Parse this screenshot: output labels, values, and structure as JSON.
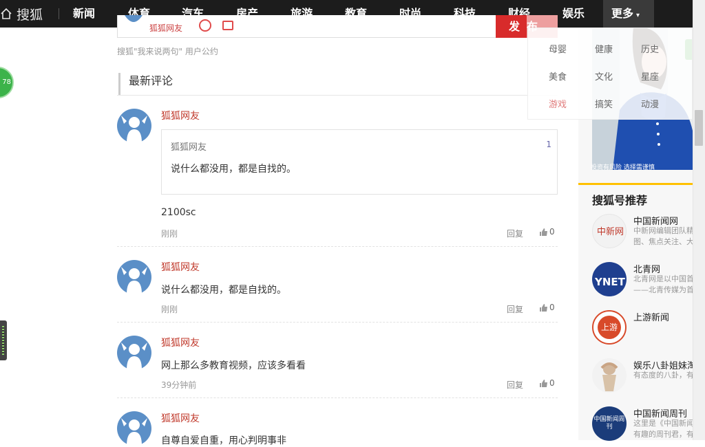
{
  "nav": {
    "logo": "搜狐",
    "items": [
      "新闻",
      "体育",
      "汽车",
      "房产",
      "旅游",
      "教育",
      "时尚",
      "科技",
      "财经",
      "娱乐"
    ],
    "more": "更多"
  },
  "more_menu": [
    "母婴",
    "健康",
    "历史",
    "美食",
    "文化",
    "星座",
    "游戏",
    "搞笑",
    "动漫"
  ],
  "comment_box": {
    "user_remnant": "狐狐网友",
    "post_button": "发布",
    "pact": "搜狐\"我来说两句\" 用户公约"
  },
  "latest_title": "最新评论",
  "comments": [
    {
      "user": "狐狐网友",
      "quote": {
        "user": "狐狐网友",
        "floor": "1",
        "text": "说什么都没用，都是自找的。"
      },
      "text": "2100sc",
      "time": "刚刚",
      "reply": "回复",
      "likes": "0"
    },
    {
      "user": "狐狐网友",
      "text": "说什么都没用，都是自找的。",
      "time": "刚刚",
      "reply": "回复",
      "likes": "0"
    },
    {
      "user": "狐狐网友",
      "text": "网上那么多教育视频，应该多看看",
      "time": "39分钟前",
      "reply": "回复",
      "likes": "0"
    },
    {
      "user": "狐狐网友",
      "text": "自尊自爱自重，用心判明事非"
    }
  ],
  "float_badge": "78",
  "ad": {
    "caption": "投资有风险 选择需谨慎"
  },
  "recommend": {
    "title": "搜狐号推荐",
    "items": [
      {
        "name": "中国新闻网",
        "desc1": "中新网编辑团队精",
        "desc2": "图、焦点关注、大",
        "logo_text": "中新网"
      },
      {
        "name": "北青网",
        "desc1": "北青网是以中国首",
        "desc2": "——北青传媒为首",
        "logo_text": "YNET"
      },
      {
        "name": "上游新闻",
        "logo_text": "上游"
      },
      {
        "name": "娱乐八卦姐妹淘",
        "desc1": "有态度的八卦，有"
      },
      {
        "name": "中国新闻周刊",
        "desc1": "这里是《中国新闻",
        "desc2": "有趣的周刊君，有",
        "logo_text": "中国新闻周刊"
      }
    ]
  },
  "colors": {
    "accent_red": "#d82b2b",
    "username_red": "#c0392b",
    "nav_bg": "#1c1c1c",
    "sidebar_accent": "#ffc000",
    "badge_green": "#3cb34a"
  }
}
